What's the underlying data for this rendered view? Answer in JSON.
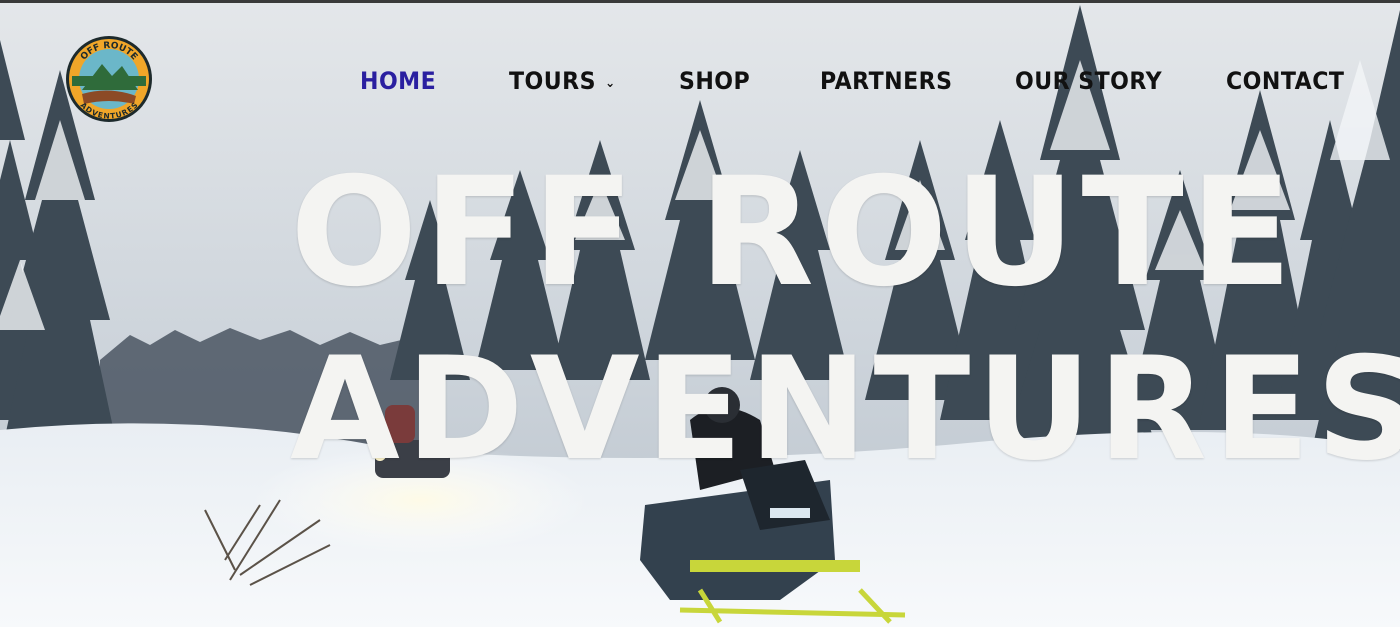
{
  "brand": {
    "logo_top_text": "OFF ROUTE",
    "logo_bottom_text": "ADVENTURES"
  },
  "nav": {
    "items": [
      {
        "label": "HOME",
        "active": true
      },
      {
        "label": "TOURS",
        "has_dropdown": true
      },
      {
        "label": "SHOP"
      },
      {
        "label": "PARTNERS"
      },
      {
        "label": "OUR STORY"
      },
      {
        "label": "CONTACT"
      }
    ],
    "dropdown_icon": "chevron-down-icon"
  },
  "hero": {
    "line1": "OFF ROUTE",
    "line2": "ADVENTURES"
  },
  "colors": {
    "nav_active": "#2a1fa0",
    "nav_text": "#111111",
    "headline": "#f4f4f2"
  }
}
